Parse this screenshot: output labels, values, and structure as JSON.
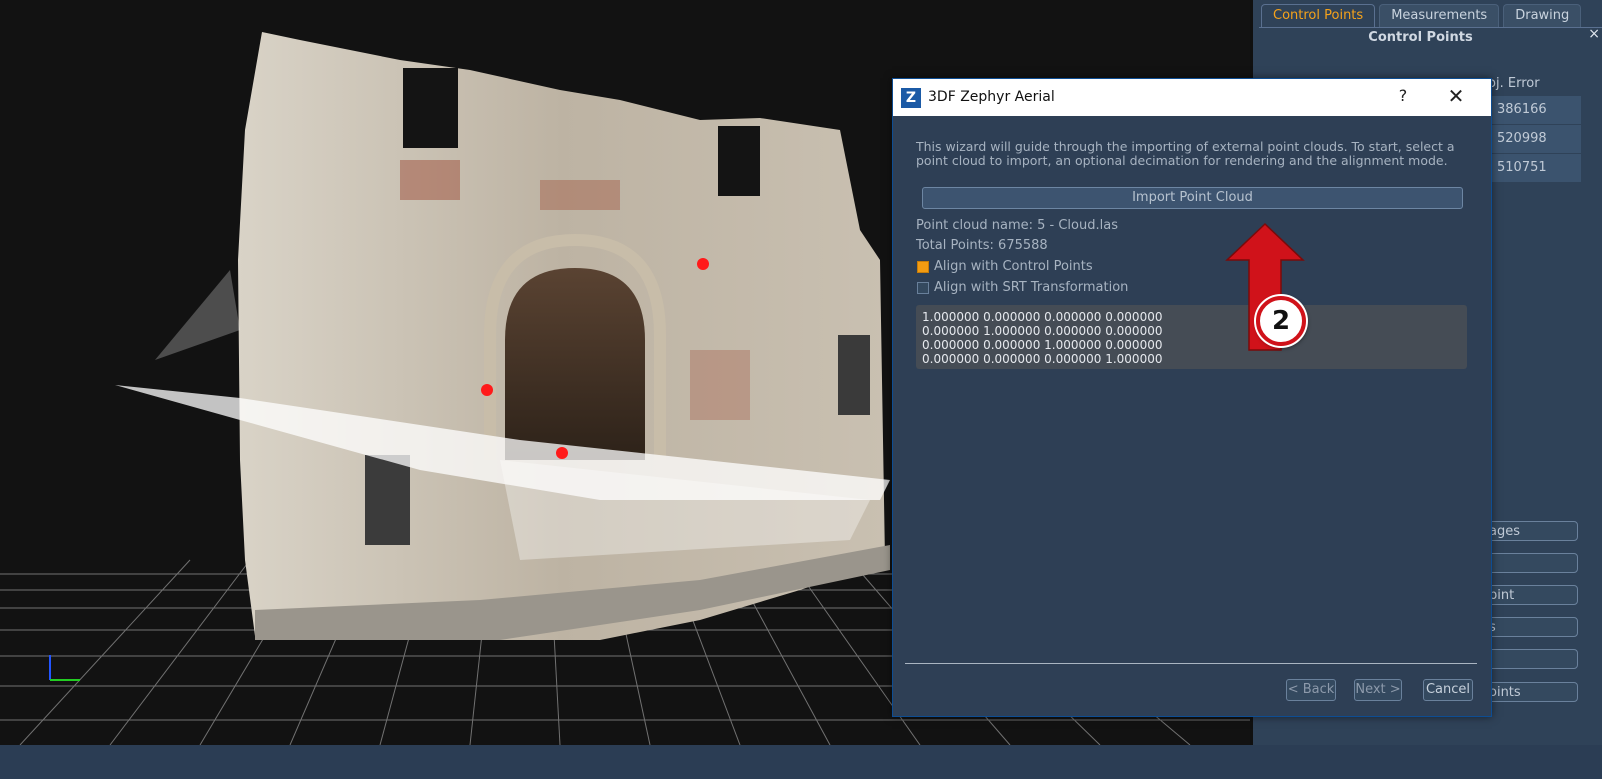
{
  "right_panel": {
    "tabs": [
      {
        "label": "Control Points",
        "active": true
      },
      {
        "label": "Measurements",
        "active": false
      },
      {
        "label": "Drawing",
        "active": false
      }
    ],
    "title": "Control Points",
    "close_glyph": "×",
    "column_header": "roj. Error",
    "rows": [
      "386166",
      "520998",
      "510751"
    ],
    "buttons": [
      "ages",
      "",
      "pint",
      "s",
      "",
      "oints"
    ]
  },
  "dialog": {
    "title": "3DF Zephyr Aerial",
    "logo_letter": "Z",
    "help_glyph": "?",
    "close_glyph": "✕",
    "intro": "This wizard will guide through the importing of external point clouds. To start, select a point cloud to import, an optional decimation for rendering and the alignment mode.",
    "import_button": "Import Point Cloud",
    "cloud_name": "Point cloud name: 5 - Cloud.las",
    "total_points": "Total Points: 675588",
    "options": [
      {
        "label": "Align with Control Points",
        "checked": true
      },
      {
        "label": "Align with SRT Transformation",
        "checked": false
      }
    ],
    "matrix": [
      "1.000000 0.000000 0.000000 0.000000",
      "0.000000 1.000000 0.000000 0.000000",
      "0.000000 0.000000 1.000000 0.000000",
      "0.000000 0.000000 0.000000 1.000000"
    ],
    "back_button": "< Back",
    "next_button": "Next >",
    "cancel_button": "Cancel"
  },
  "annotation": {
    "step_number": "2"
  },
  "colors": {
    "panel_bg": "#2f4258",
    "dialog_bg": "#2e3f55",
    "accent_orange": "#f39c12",
    "arrow_red": "#d0121a",
    "marker_red": "#ff1a1a"
  }
}
